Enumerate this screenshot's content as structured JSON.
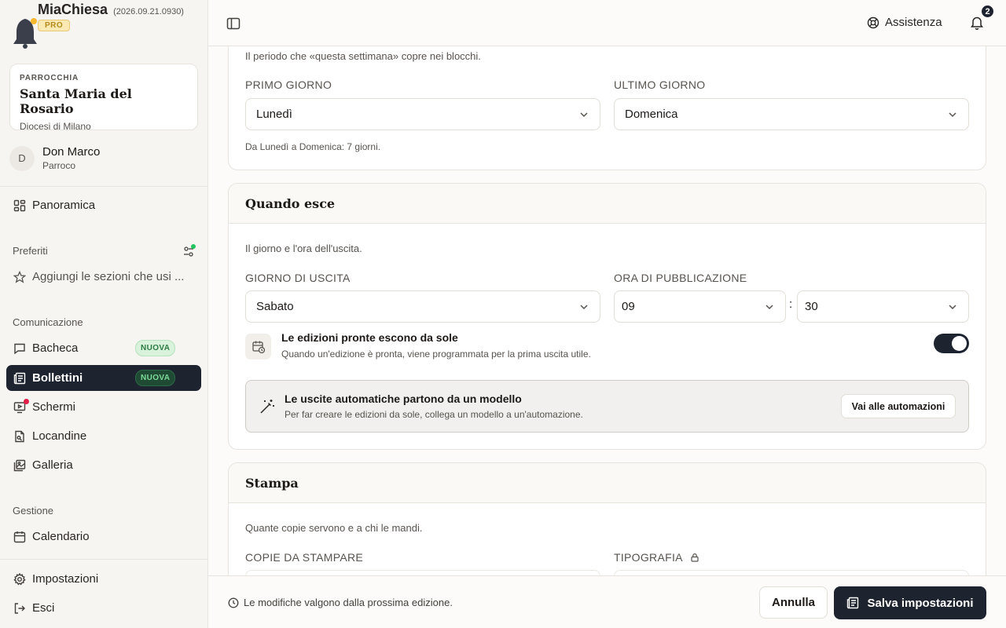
{
  "app": {
    "name": "MiaChiesa",
    "version": "(2026.09.21.0930)",
    "plan": "PRO"
  },
  "parish": {
    "label": "PARROCCHIA",
    "name": "Santa Maria del Rosario",
    "diocese": "Diocesi di Milano"
  },
  "user": {
    "initial": "D",
    "name": "Don Marco",
    "role": "Parroco"
  },
  "sidebar": {
    "overview": "Panoramica",
    "favorites_title": "Preferiti",
    "favorites_add": "Aggiungi le sezioni che usi ...",
    "communication_title": "Comunicazione",
    "items": [
      {
        "label": "Bacheca",
        "badge": "NUOVA"
      },
      {
        "label": "Bollettini",
        "badge": "NUOVA"
      },
      {
        "label": "Schermi"
      },
      {
        "label": "Locandine"
      },
      {
        "label": "Galleria"
      }
    ],
    "management_title": "Gestione",
    "calendar": "Calendario",
    "settings": "Impostazioni",
    "logout": "Esci"
  },
  "topbar": {
    "help": "Assistenza",
    "notifications": "2"
  },
  "week": {
    "description": "Il periodo che «questa settimana» copre nei blocchi.",
    "first_day_label": "PRIMO GIORNO",
    "first_day_value": "Lunedì",
    "last_day_label": "ULTIMO GIORNO",
    "last_day_value": "Domenica",
    "hint": "Da Lunedì a Domenica: 7 giorni."
  },
  "release": {
    "title": "Quando esce",
    "description": "Il giorno e l'ora dell'uscita.",
    "day_label": "GIORNO DI USCITA",
    "day_value": "Sabato",
    "time_label": "ORA DI PUBBLICAZIONE",
    "hour_value": "09",
    "separator": ":",
    "minute_value": "30",
    "auto_title": "Le edizioni pronte escono da sole",
    "auto_sub": "Quando un'edizione è pronta, viene programmata per la prima uscita utile.",
    "auto_enabled": true,
    "model_title": "Le uscite automatiche partono da un modello",
    "model_sub": "Per far creare le edizioni da sole, collega un modello a un'automazione.",
    "model_button": "Vai alle automazioni"
  },
  "print": {
    "title": "Stampa",
    "description": "Quante copie servono e a chi le mandi.",
    "copies_label": "COPIE DA STAMPARE",
    "printer_label": "TIPOGRAFIA"
  },
  "footer": {
    "note": "Le modifiche valgono dalla prossima edizione.",
    "cancel": "Annulla",
    "save": "Salva impostazioni"
  },
  "colors": {
    "accent": "#1e2330",
    "badge_green": "#2e7a44",
    "notification_dot": "#e11d48",
    "pro_gold": "#b58b1d"
  }
}
